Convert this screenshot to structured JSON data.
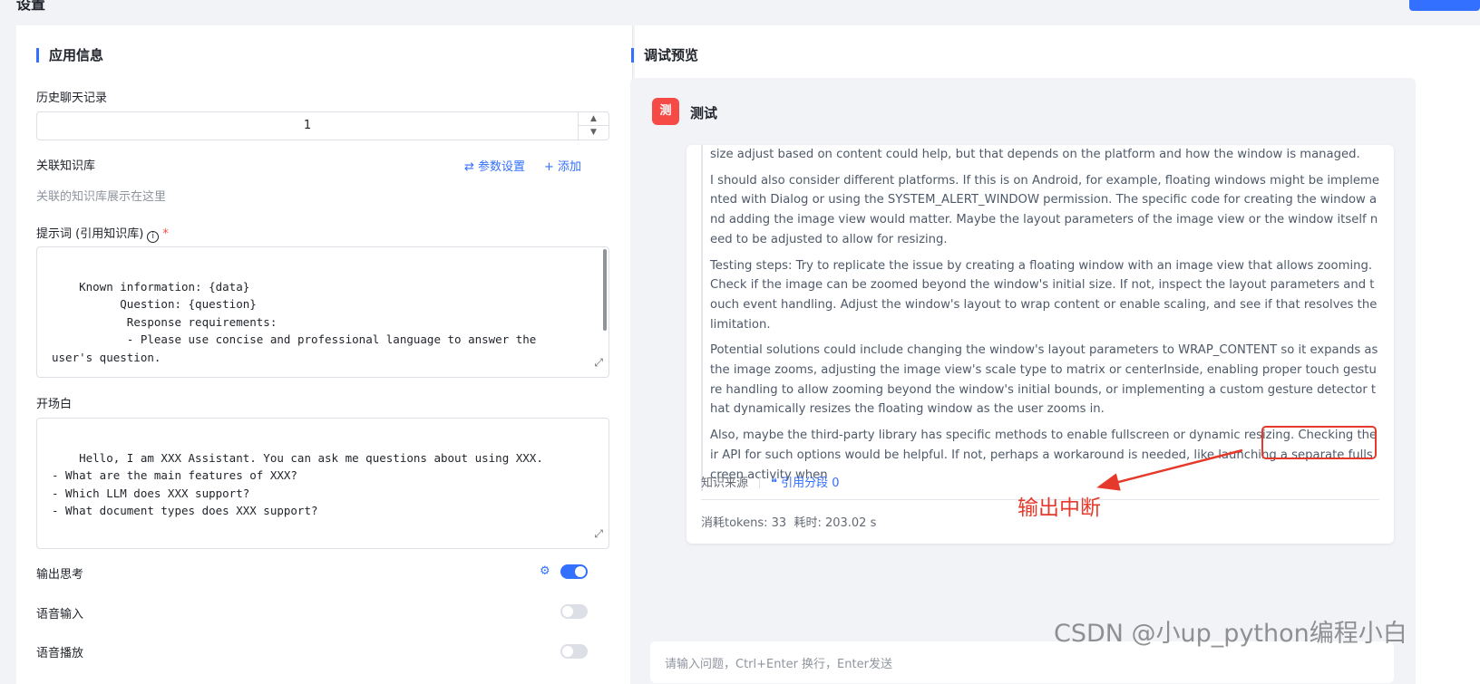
{
  "page": {
    "title": "设置"
  },
  "left": {
    "section_title": "应用信息",
    "history": {
      "label": "历史聊天记录",
      "value": "1",
      "up": "▲",
      "down": "▼"
    },
    "kb": {
      "label": "关联知识库",
      "param_btn": "⇄ 参数设置",
      "add_btn": "+ 添加",
      "hint": "关联的知识库展示在这里"
    },
    "prompt": {
      "label": "提示词 (引用知识库)",
      "info_icon": "i",
      "required": "*",
      "text": "Known information: {data}\n          Question: {question}\n           Response requirements:\n           - Please use concise and professional language to answer the\nuser's question."
    },
    "opening": {
      "label": "开场白",
      "text": "Hello, I am XXX Assistant. You can ask me questions about using XXX.\n- What are the main features of XXX?\n- Which LLM does XXX support?\n- What document types does XXX support?"
    },
    "output_thinking": {
      "label": "输出思考",
      "on": true,
      "gear": "⚙"
    },
    "voice_input": {
      "label": "语音输入",
      "on": false
    },
    "voice_play": {
      "label": "语音播放",
      "on": false
    },
    "expand_icon": "⤢"
  },
  "right": {
    "section_title": "调试预览",
    "app_avatar": "测",
    "app_name": "测试",
    "thought_paragraphs": [
      "size adjust based on content could help, but that depends on the platform and how the window is managed.",
      "I should also consider different platforms. If this is on Android, for example, floating windows might be implemented with Dialog or using the SYSTEM_ALERT_WINDOW permission. The specific code for creating the window and adding the image view would matter. Maybe the layout parameters of the image view or the window itself need to be adjusted to allow for resizing.",
      "Testing steps: Try to replicate the issue by creating a floating window with an image view that allows zooming. Check if the image can be zoomed beyond the window's initial size. If not, inspect the layout parameters and touch event handling. Adjust the window's layout to wrap content or enable scaling, and see if that resolves the limitation.",
      "Potential solutions could include changing the window's layout parameters to WRAP_CONTENT so it expands as the image zooms, adjusting the image view's scale type to matrix or centerInside, enabling proper touch gesture handling to allow zooming beyond the window's initial bounds, or implementing a custom gesture detector that dynamically resizes the floating window as the user zooms in.",
      "Also, maybe the third-party library has specific methods to enable fullscreen or dynamic resizing. Checking their API for such options would be helpful. If not, perhaps a workaround is needed, like launching a separate fullscreen activity when"
    ],
    "sources_label": "知识来源",
    "cite_label": "❝ 引用分段 0",
    "tokens_label": "消耗tokens: 33",
    "time_label": "耗时: 203.02 s",
    "input_placeholder": "请输入问题，Ctrl+Enter 换行，Enter发送"
  },
  "annotation": {
    "text": "输出中断",
    "color": "#e53a2b"
  },
  "watermark": "CSDN @小up_python编程小白"
}
